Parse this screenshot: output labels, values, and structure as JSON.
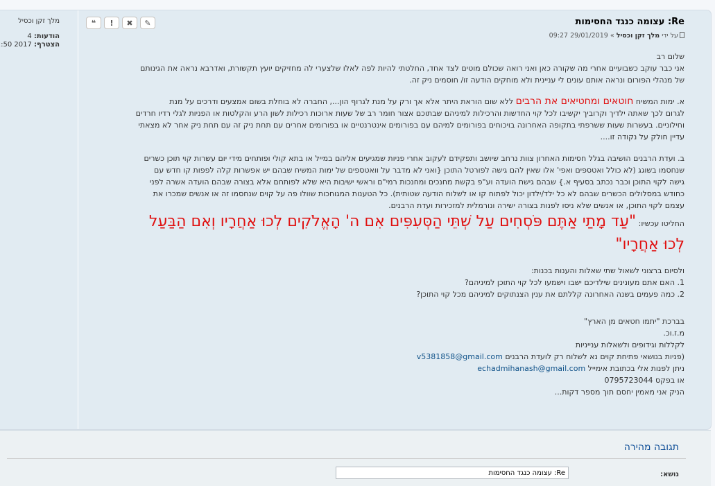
{
  "post": {
    "title": "Re: עצומה כנגד החסימות",
    "meta_prefix": "על ידי",
    "author": "מלך זקן וכסיל",
    "meta_sep": "»",
    "date": "29/01/2019 09:27",
    "buttons": {
      "edit": "✎",
      "delete": "✖",
      "report": "!",
      "quote": "❝"
    },
    "lines": {
      "greeting": "שלום רב",
      "intro_1": "אני כבר עוקב כשבועיים אחרי מה שקורה כאן ואני רואה שכולם מוטים לצד אחד, החלטתי להיות לפה לאלו שלצערי לה מחזיקים יועץ תקשורת, ואדרבא נראה את הגינותם",
      "intro_2": "של מנהלי הפורום ונראה אותם עונים לי עניינית ולא מוחקים הודעה זו/ חוסמים ניק זה.",
      "a_prefix": "א. ימות המשיח ",
      "a_red": "חוטאים ומחטיאים את הרבים",
      "a_rest": " ללא שום הוראת היתר אלא אך ורק על מנת לגרוף הון..., החברה לא בוחלת בשום אמצעים ודרכים על מנת",
      "a_2": "לגרום לכך שאתה ילדיך וקרוביך יקשיבו לכל קוי החדשות והרכילות למיניהם שבתוכם אצור חומר רב של שעות ארוכות רכילות לשון הרע והקלטות או הפניות לגלי רדיו חרדים",
      "a_3": "וחילוניים. בעשרות שעות ששרפתי בתקופה האחרונה בויכוחים בפורומים למיהם עם בפורומים אינטרנטיים או בפורומים אחרים עם תחת ניק זה עם תחת ניק אחר לא מצאתי",
      "a_4": "עדיין חולק על נקודה זו....",
      "b_1": "ב. ועדת הרבנים הושיבה בגלל חסימות האחרון צוות נרחב שיושב ותפקידם לעקוב אחרי פניות שמגיעים אליהם במייל או בתא קולי ופותחים מידי יום עשרות קוי תוכן כשרים",
      "b_2": "שנחסמו בשוגג (לא כולל ואטספים ואפי' אלו שאין להם גישה לפורטל התוכן {ואני לא מדבר על וואטספים של ימות המשיח שבהם יש אפשרות קלה לפפות קו חדש עם",
      "b_3": "גישה לקוי התוכן וכבר נכתב בסעיף א.} שבהם גישת הועדה וע\"פ בקשת מחנכים ומחנכות רמי\"ם וראשי ישיבות היא שלא לפותחם אלא בצורה שבהם הועדה אשרה לפני",
      "b_4": "כחודש במסלולים הכשרים שבהם לא כל ילד/ילדון יכול לפתוח קו או לשלוח הודעה שטותית). כל הטענות המגוחכות שוולו פה על קוים שנחסמו זה או אנשים שמכרו את",
      "b_5": "עצמם לקוי התוכן, או אנשים שלא ניסו לפנות בצורה ישירה ונורמלית למזכירות ועדת הרבנים.",
      "conclusion_label": "החליטו עכשיו: ",
      "verse_1": "\"עַד מָתַי אַתֶּם פֹּסְחִים עַל שְׁתֵּי הַסְּעִפִּים אִם ה' הָאֱלֹקִים לְכוּ אַחֲרָיו וְאִם הַבַּעַל",
      "verse_2": "לְכוּ אַחֲרָיו\"",
      "q_intro": "ולסיום ברצוני לשאול שתי שאלות והענות בכנות:",
      "q_1": "1. האם אתם מעונינים שילדיכם ישבו וישמעו לכל קוי התוכן למיניהם?",
      "q_2": "2. כמה פעמים בשנה האחרונה קללתם את ענין הצנתוקים למיניהם מכל קוי התוכן?",
      "sign_1": "בברכת \"יתמו חטאים מן הארץ\"",
      "sign_2": "מ.ז.וכ.",
      "sign_3": "לקללות וגידופים ולשאלות ענייניות",
      "sign_4_text": "(פניות בנושאי פתיחת קוים נא לשלוח רק לועדת הרבנים ",
      "sign_4_mail": "v5381858@gmail.com",
      "sign_5_text": "ניתן לפנות אלי בכתובת אימייל ",
      "sign_5_mail": "echadmihanash@gmail.com",
      "sign_6": "או בפקס 0795723044",
      "sign_7": "הניק אני מאמין יחסם תוך מספר דקות..."
    }
  },
  "profile": {
    "username": "מלך זקן וכסיל",
    "posts_label": "הודעות:",
    "posts_value": "4",
    "joined_label": "הצטרף:",
    "joined_value": "2017 12:50"
  },
  "quick_reply": {
    "title": "תגובה מהירה",
    "subject_label": "נושא:",
    "subject_value": "Re: עצומה כנגד החסימות"
  },
  "colors": {
    "post_bg": "#e1ebf2",
    "highlight_red": "#e01010",
    "link_blue": "#105289"
  }
}
